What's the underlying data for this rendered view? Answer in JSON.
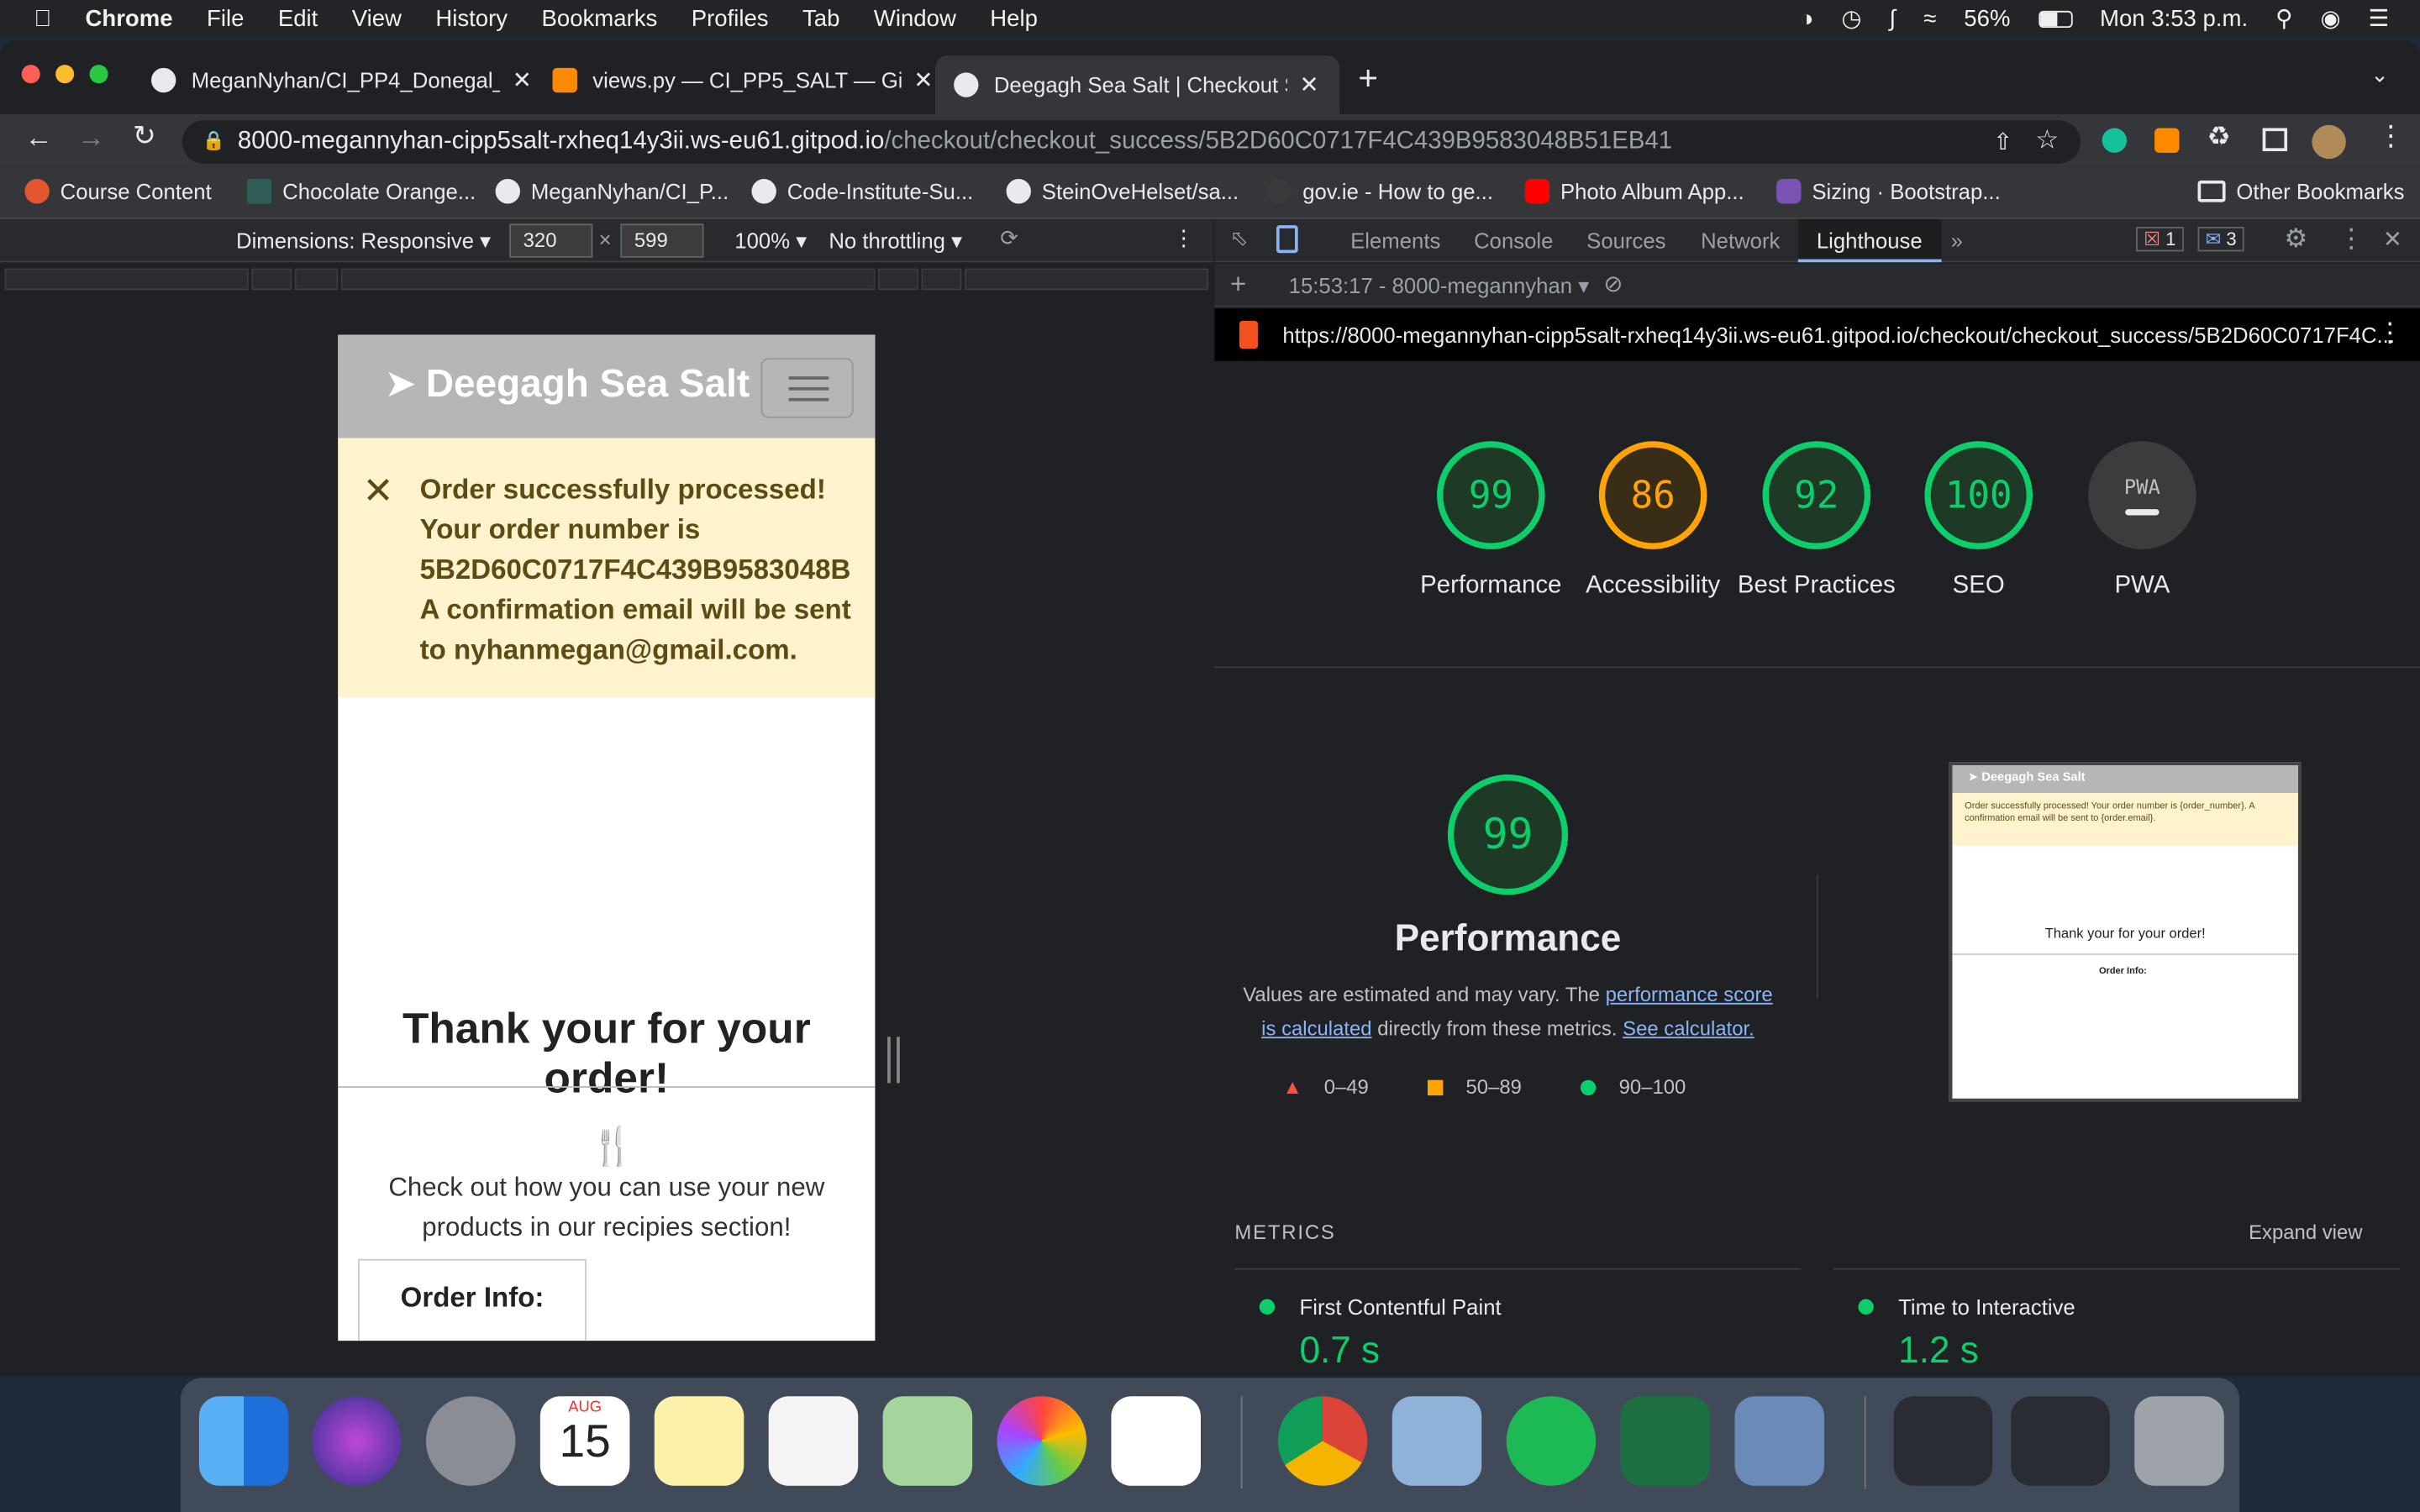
{
  "menubar": {
    "app": "Chrome",
    "items": [
      "File",
      "Edit",
      "View",
      "History",
      "Bookmarks",
      "Profiles",
      "Tab",
      "Window",
      "Help"
    ],
    "battery": "56%",
    "clock": "Mon 3:53 p.m."
  },
  "tabs": [
    {
      "title": "MeganNyhan/CI_PP4_Donegal_"
    },
    {
      "title": "views.py — CI_PP5_SALT — Gi"
    },
    {
      "title": "Deegagh Sea Salt | Checkout S"
    }
  ],
  "address": {
    "host": "8000-megannyhan-cipp5salt-rxheq14y3ii.ws-eu61.gitpod.io",
    "path": "/checkout/checkout_success/5B2D60C0717F4C439B9583048B51EB41"
  },
  "bookmarks": [
    "Course Content",
    "Chocolate Orange...",
    "MeganNyhan/CI_P...",
    "Code-Institute-Su...",
    "SteinOveHelset/sa...",
    "gov.ie - How to ge...",
    "Photo Album App...",
    "Sizing · Bootstrap..."
  ],
  "other_bookmarks": "Other Bookmarks",
  "device_toolbar": {
    "dimensions": "Dimensions: Responsive",
    "width": "320",
    "height": "599",
    "x": "×",
    "zoom": "100%",
    "throttling": "No throttling"
  },
  "page": {
    "brand": "Deegagh Sea Salt",
    "alert_lines": [
      "Order successfully processed!",
      "Your order number is",
      "5B2D60C0717F4C439B9583048B",
      "A confirmation email will be sent",
      "to nyhanmegan@gmail.com."
    ],
    "thanks": "Thank your for your order!",
    "recipe_text": "Check out how you can use your new products in our recipies section!",
    "order_info": "Order Info:"
  },
  "devtools": {
    "tabs": [
      "Elements",
      "Console",
      "Sources",
      "Network",
      "Lighthouse"
    ],
    "errors": "1",
    "messages": "3",
    "report_label": "15:53:17 - 8000-megannyhan",
    "report_url": "https://8000-megannyhan-cipp5salt-rxheq14y3ii.ws-eu61.gitpod.io/checkout/checkout_success/5B2D60C0717F4C..."
  },
  "scores": [
    {
      "value": "99",
      "label": "Performance"
    },
    {
      "value": "86",
      "label": "Accessibility"
    },
    {
      "value": "92",
      "label": "Best Practices"
    },
    {
      "value": "100",
      "label": "SEO"
    },
    {
      "value": "PWA",
      "label": "PWA"
    }
  ],
  "performance": {
    "score": "99",
    "title": "Performance",
    "desc_1": "Values are estimated and may vary. The ",
    "link_1": "performance score is calculated",
    "desc_2": " directly from these metrics. ",
    "link_2": "See calculator.",
    "legend": [
      "0–49",
      "50–89",
      "90–100"
    ]
  },
  "thumbnail": {
    "brand": "Deegagh Sea Salt",
    "alert": "Order successfully processed! Your order number is {order_number}. A confirmation email will be sent to {order.email}.",
    "thanks": "Thank your for your order!",
    "order_info": "Order Info:"
  },
  "metrics": {
    "heading": "METRICS",
    "expand": "Expand view",
    "items": [
      {
        "name": "First Contentful Paint",
        "value": "0.7 s"
      },
      {
        "name": "Time to Interactive",
        "value": "1.2 s"
      }
    ]
  },
  "dock_calendar": {
    "month": "AUG",
    "day": "15"
  },
  "colors": {
    "pass": "#0cce6b",
    "average": "#ffa400",
    "fail": "#ff4e42"
  }
}
